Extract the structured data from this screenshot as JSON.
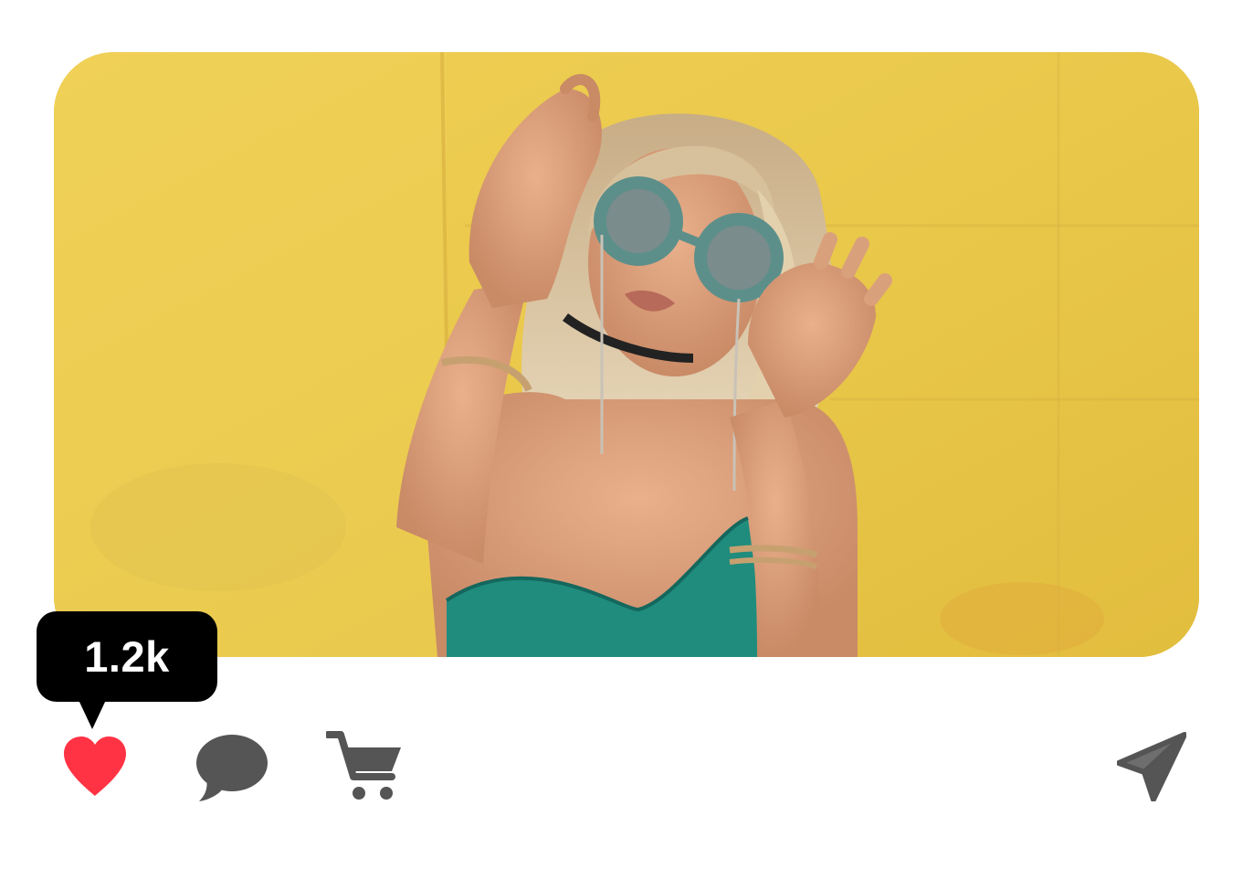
{
  "post": {
    "image": {
      "description_icon": "photo-icon"
    },
    "likes": {
      "count_label": "1.2k"
    },
    "actions": [
      {
        "name": "like",
        "icon": "heart-icon",
        "color": "#ff3344"
      },
      {
        "name": "comment",
        "icon": "speech-bubble-icon",
        "color": "#555555"
      },
      {
        "name": "cart",
        "icon": "shopping-cart-icon",
        "color": "#555555"
      },
      {
        "name": "share",
        "icon": "paper-plane-icon",
        "color": "#555555"
      }
    ]
  },
  "colors": {
    "background": "#ffffff",
    "tooltip": "#000000",
    "tooltip_text": "#ffffff",
    "like": "#ff3344",
    "icon": "#555555",
    "photo_wall": "#e8c84a"
  }
}
